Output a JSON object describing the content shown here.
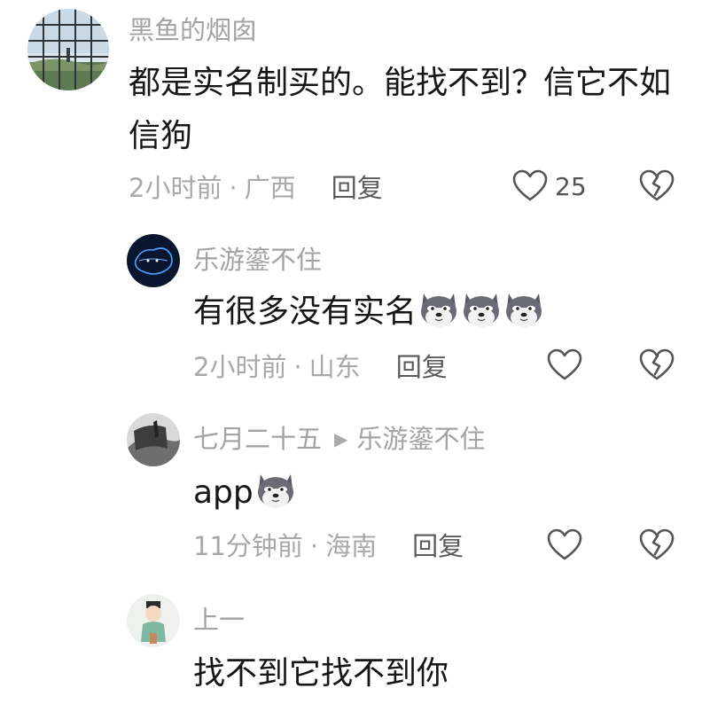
{
  "comments": [
    {
      "username": "黑鱼的烟囱",
      "content": "都是实名制买的。能找不到？信它不如信狗",
      "time": "2小时前",
      "location": "广西",
      "reply_label": "回复",
      "likes": "25"
    },
    {
      "username": "乐游鎏不住",
      "content": "有很多没有实名",
      "emoji_count": 3,
      "time": "2小时前",
      "location": "山东",
      "reply_label": "回复"
    },
    {
      "username": "七月二十五",
      "reply_to": "乐游鎏不住",
      "content": "app",
      "emoji_count": 1,
      "time": "11分钟前",
      "location": "海南",
      "reply_label": "回复"
    },
    {
      "username": "上一",
      "content": "找不到它找不到你"
    }
  ],
  "icons": {
    "like": "heart-outline-icon",
    "dislike": "broken-heart-icon",
    "emoji": "wolf-emoji-icon",
    "reply_arrow": "triangle-right-icon"
  }
}
